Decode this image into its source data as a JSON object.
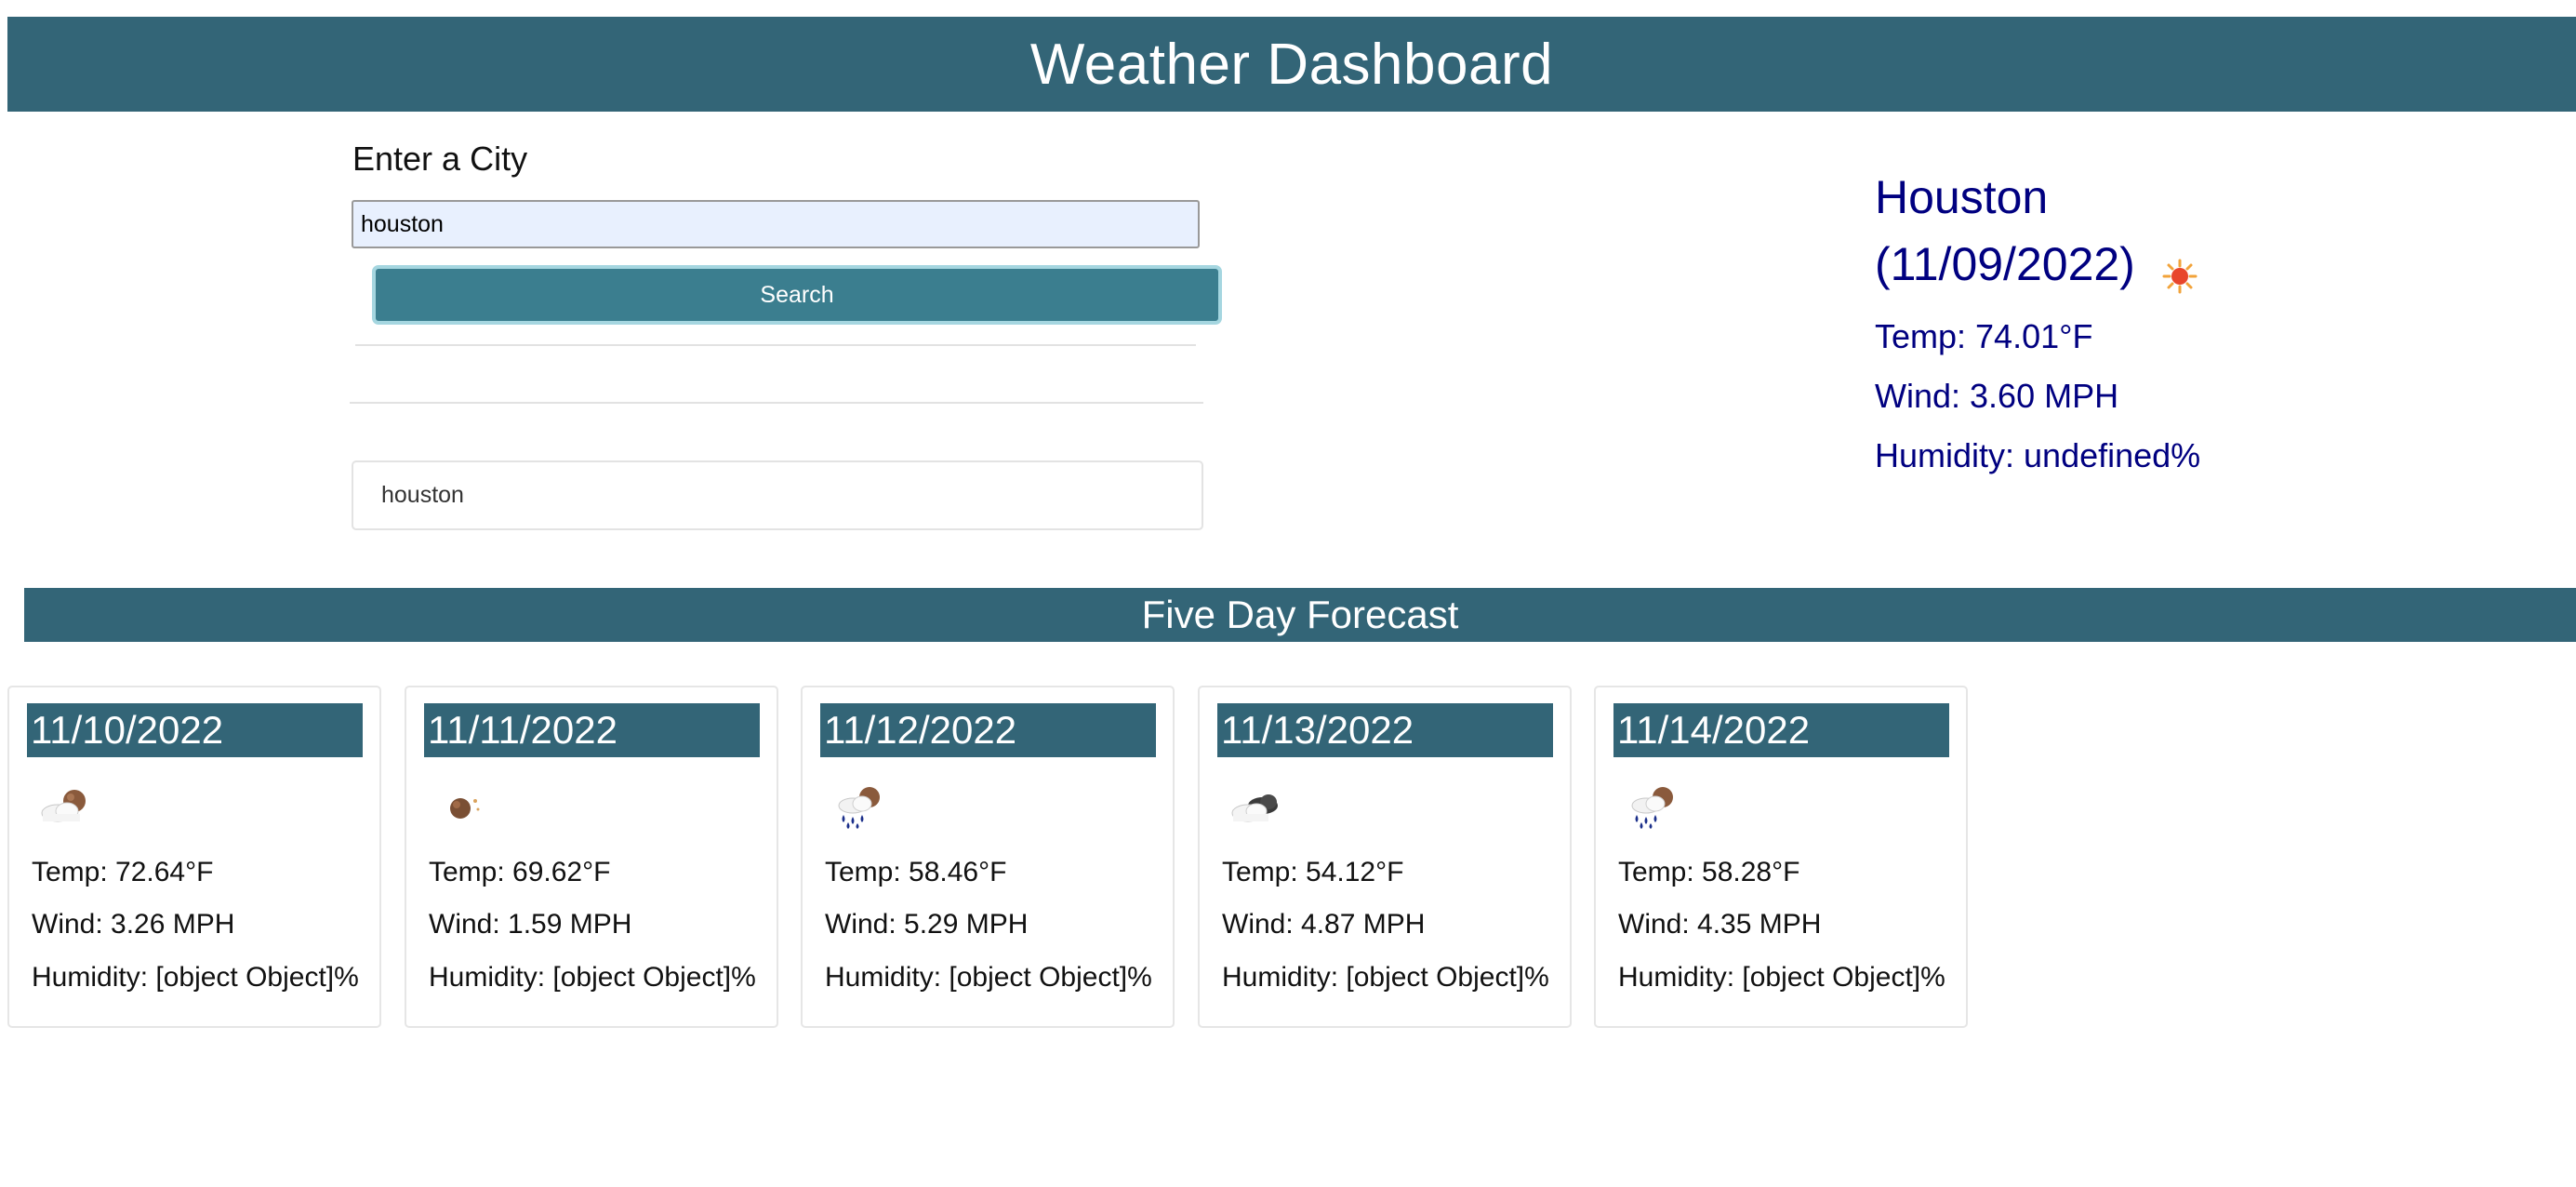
{
  "header": {
    "title": "Weather Dashboard"
  },
  "search": {
    "label": "Enter a City",
    "input_value": "houston",
    "button_label": "Search",
    "history": [
      "houston"
    ]
  },
  "current": {
    "city": "Houston",
    "date": "(11/09/2022)",
    "icon": "sun-icon",
    "temp": "Temp: 74.01°F",
    "wind": "Wind: 3.60 MPH",
    "humidity": "Humidity: undefined%"
  },
  "forecast": {
    "title": "Five Day Forecast",
    "days": [
      {
        "date": "11/10/2022",
        "icon": "partly-cloudy-night-icon",
        "temp": "Temp: 72.64°F",
        "wind": "Wind: 3.26 MPH",
        "humidity": "Humidity: [object Object]%"
      },
      {
        "date": "11/11/2022",
        "icon": "clear-night-icon",
        "temp": "Temp: 69.62°F",
        "wind": "Wind: 1.59 MPH",
        "humidity": "Humidity: [object Object]%"
      },
      {
        "date": "11/12/2022",
        "icon": "rain-night-icon",
        "temp": "Temp: 58.46°F",
        "wind": "Wind: 5.29 MPH",
        "humidity": "Humidity: [object Object]%"
      },
      {
        "date": "11/13/2022",
        "icon": "cloudy-icon",
        "temp": "Temp: 54.12°F",
        "wind": "Wind: 4.87 MPH",
        "humidity": "Humidity: [object Object]%"
      },
      {
        "date": "11/14/2022",
        "icon": "rain-night-icon",
        "temp": "Temp: 58.28°F",
        "wind": "Wind: 4.35 MPH",
        "humidity": "Humidity: [object Object]%"
      }
    ]
  },
  "colors": {
    "header_bg": "#336577",
    "button_bg": "#3b7e8f",
    "current_text": "#000080",
    "input_bg": "#e8f0fe"
  }
}
